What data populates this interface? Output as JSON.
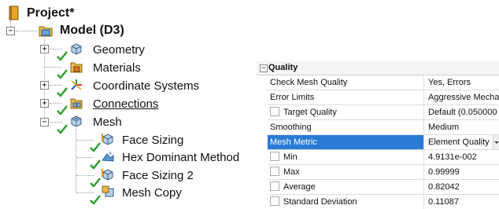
{
  "tree": {
    "project": "Project*",
    "model": "Model (D3)",
    "children": {
      "geometry": "Geometry",
      "materials": "Materials",
      "coordinate_systems": "Coordinate Systems",
      "connections": "Connections",
      "mesh": "Mesh"
    },
    "mesh_children": {
      "face_sizing": "Face Sizing",
      "hex_dominant": "Hex Dominant Method",
      "face_sizing_2": "Face Sizing 2",
      "mesh_copy": "Mesh Copy"
    },
    "collapse_symbol": "−",
    "expand_symbol": "+"
  },
  "quality_panel": {
    "title": "Quality",
    "collapse_symbol": "−",
    "rows": {
      "check_mesh_quality": {
        "label": "Check Mesh Quality",
        "value": "Yes, Errors"
      },
      "error_limits": {
        "label": "Error Limits",
        "value": "Aggressive Mecha"
      },
      "target_quality": {
        "label": "Target Quality",
        "value": "Default (0.050000"
      },
      "smoothing": {
        "label": "Smoothing",
        "value": "Medium"
      },
      "mesh_metric": {
        "label": "Mesh Metric",
        "value": "Element Quality"
      },
      "min": {
        "label": "Min",
        "value": "4.9131e-002"
      },
      "max": {
        "label": "Max",
        "value": "0.99999"
      },
      "average": {
        "label": "Average",
        "value": "0.82042"
      },
      "std_dev": {
        "label": "Standard Deviation",
        "value": "0.11087"
      }
    }
  },
  "colors": {
    "selection": "#2a7bd6",
    "check_green": "#2e9d2e",
    "folder_yellow": "#e8b84a"
  }
}
